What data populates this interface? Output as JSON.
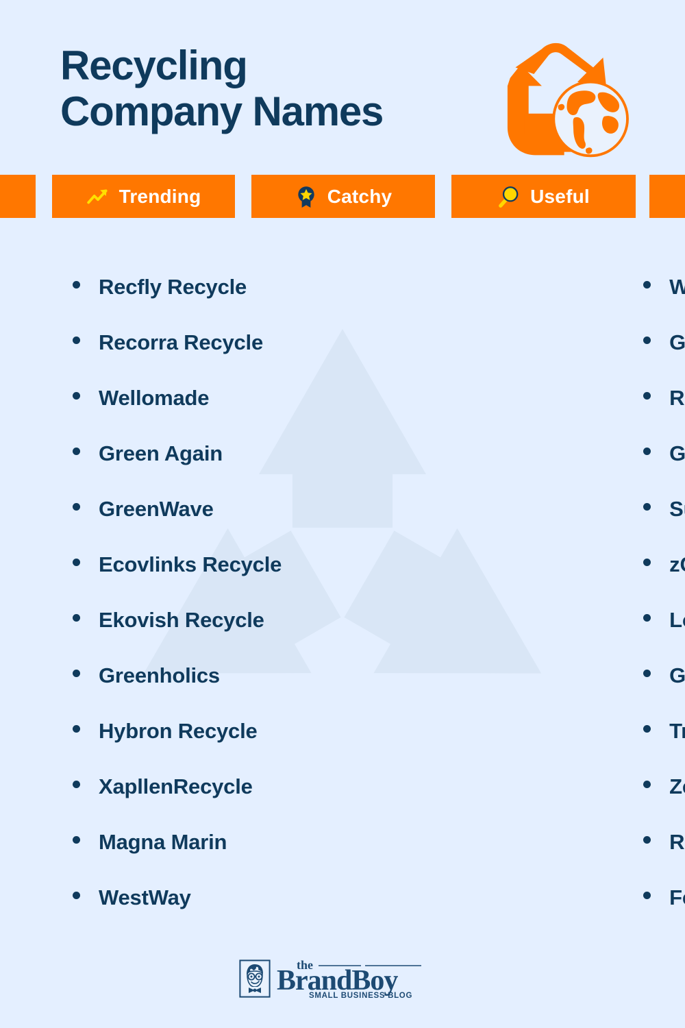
{
  "page": {
    "background_color": "#e4efff",
    "accent_color": "#ff7700",
    "text_color": "#0f3a5c",
    "highlight_color": "#ffd700"
  },
  "header": {
    "title": "Recycling\nCompany Names",
    "title_line_1": "Recycling",
    "title_line_2": "Company Names",
    "logo_icon": "recycling-globe-icon"
  },
  "badges": [
    {
      "label": "Trending",
      "icon": "trend-up-arrow-icon"
    },
    {
      "label": "Catchy",
      "icon": "award-ribbon-star-icon"
    },
    {
      "label": "Useful",
      "icon": "magnifying-glass-icon"
    }
  ],
  "lists": {
    "left_column": [
      "Recfly Recycle",
      "Recorra Recycle",
      "Wellomade",
      "Green Again",
      "GreenWave",
      "Ecovlinks Recycle",
      "Ekovish Recycle",
      "Greenholics",
      "Hybron Recycle",
      "XapllenRecycle",
      "Magna Marin",
      "WestWay"
    ],
    "right_column": [
      "WaveBlend",
      "Greenmatrix",
      "Recycle Crest",
      "GreenDream",
      "Sunray Recycle",
      "zCycle Recycle",
      "LocuGreen",
      "Green Spring",
      "Truefoil Recycle",
      "Zexxen Recycle",
      "Recyclo CO",
      "Feuberro Recycle"
    ]
  },
  "footer": {
    "brand_the": "the",
    "brand_name": "BrandBoy",
    "brand_tagline": "SMALL BUSINESS BLOG",
    "avatar_icon": "brandboy-face-icon"
  }
}
